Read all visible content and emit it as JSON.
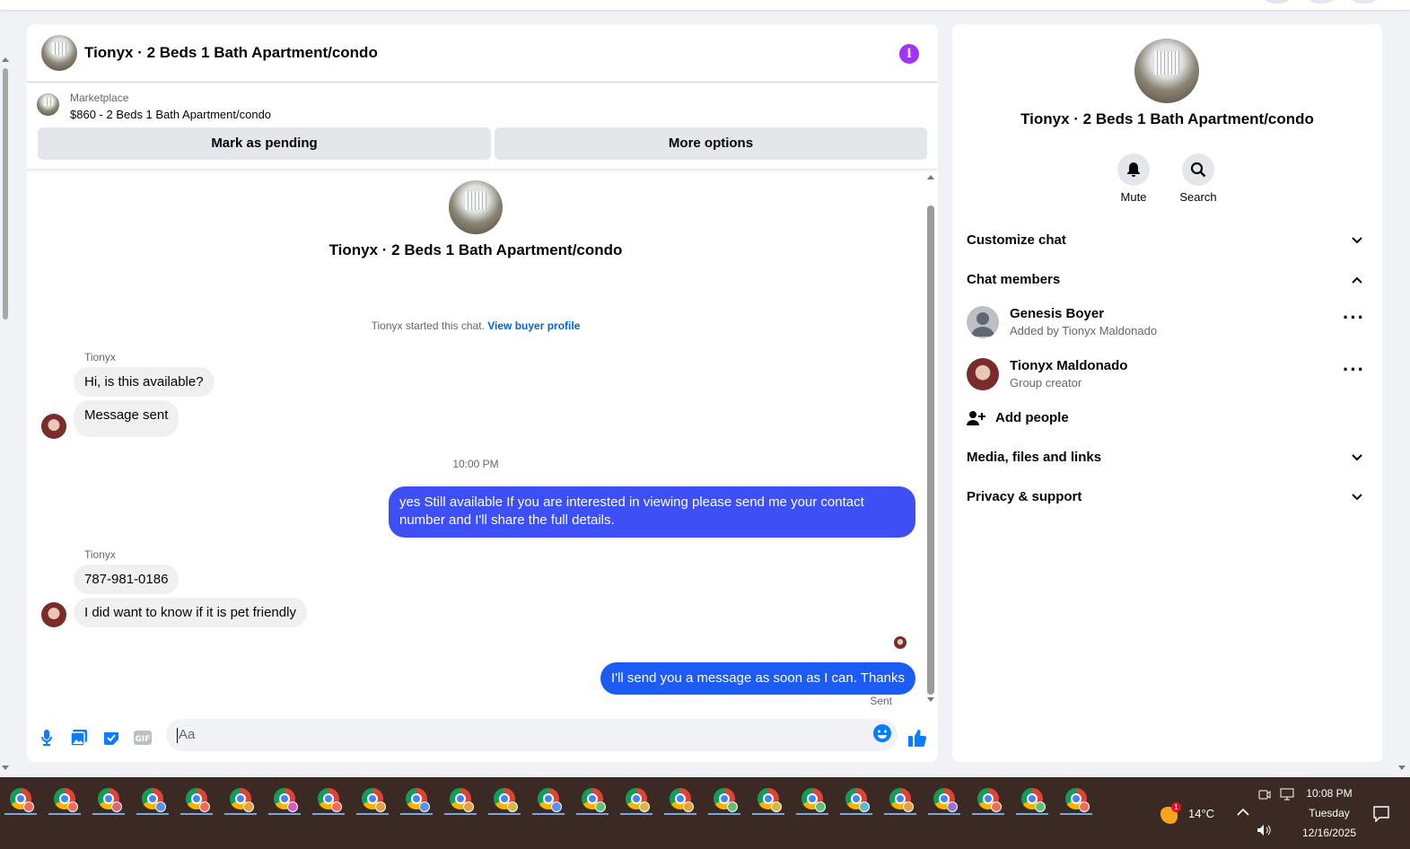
{
  "chat": {
    "title": "Tionyx · 2 Beds 1 Bath Apartment/condo",
    "marketplace_label": "Marketplace",
    "listing": "$860 - 2 Beds 1 Bath Apartment/condo",
    "mark_pending": "Mark as pending",
    "more_options": "More options",
    "center_title": "Tionyx · 2 Beds 1 Bath Apartment/condo",
    "started_text": "Tionyx started this chat.",
    "buyer_profile_link": "View buyer profile",
    "messages": [
      {
        "sender": "Tionyx",
        "text": "Hi, is this available?"
      },
      {
        "text": "Message sent"
      },
      {
        "timestamp": "10:00 PM"
      },
      {
        "text": "yes Still available If you are interested in viewing please send me your contact number and I'll share the full details."
      },
      {
        "sender": "Tionyx",
        "text": "787-981-0186"
      },
      {
        "text": "I did want to know if it is pet friendly"
      },
      {
        "text": "I'll send you a message as soon as I can. Thanks"
      }
    ],
    "sent_label": "Sent",
    "input_placeholder": "Aa"
  },
  "sidebar": {
    "title": "Tionyx · 2 Beds 1 Bath Apartment/condo",
    "mute_label": "Mute",
    "search_label": "Search",
    "customize_chat": "Customize chat",
    "chat_members": "Chat members",
    "members": [
      {
        "name": "Genesis Boyer",
        "sub": "Added by Tionyx Maldonado"
      },
      {
        "name": "Tionyx Maldonado",
        "sub": "Group creator"
      }
    ],
    "add_people": "Add people",
    "media": "Media, files and links",
    "privacy": "Privacy & support"
  },
  "taskbar": {
    "temperature": "14°C",
    "weather_badge": "1",
    "time": "10:08 PM",
    "day": "Tuesday",
    "date": "12/16/2025"
  },
  "colors": {
    "accent_purple": "#a033ff",
    "outgoing_bubble": "#3d50f5",
    "link": "#0064d1"
  }
}
